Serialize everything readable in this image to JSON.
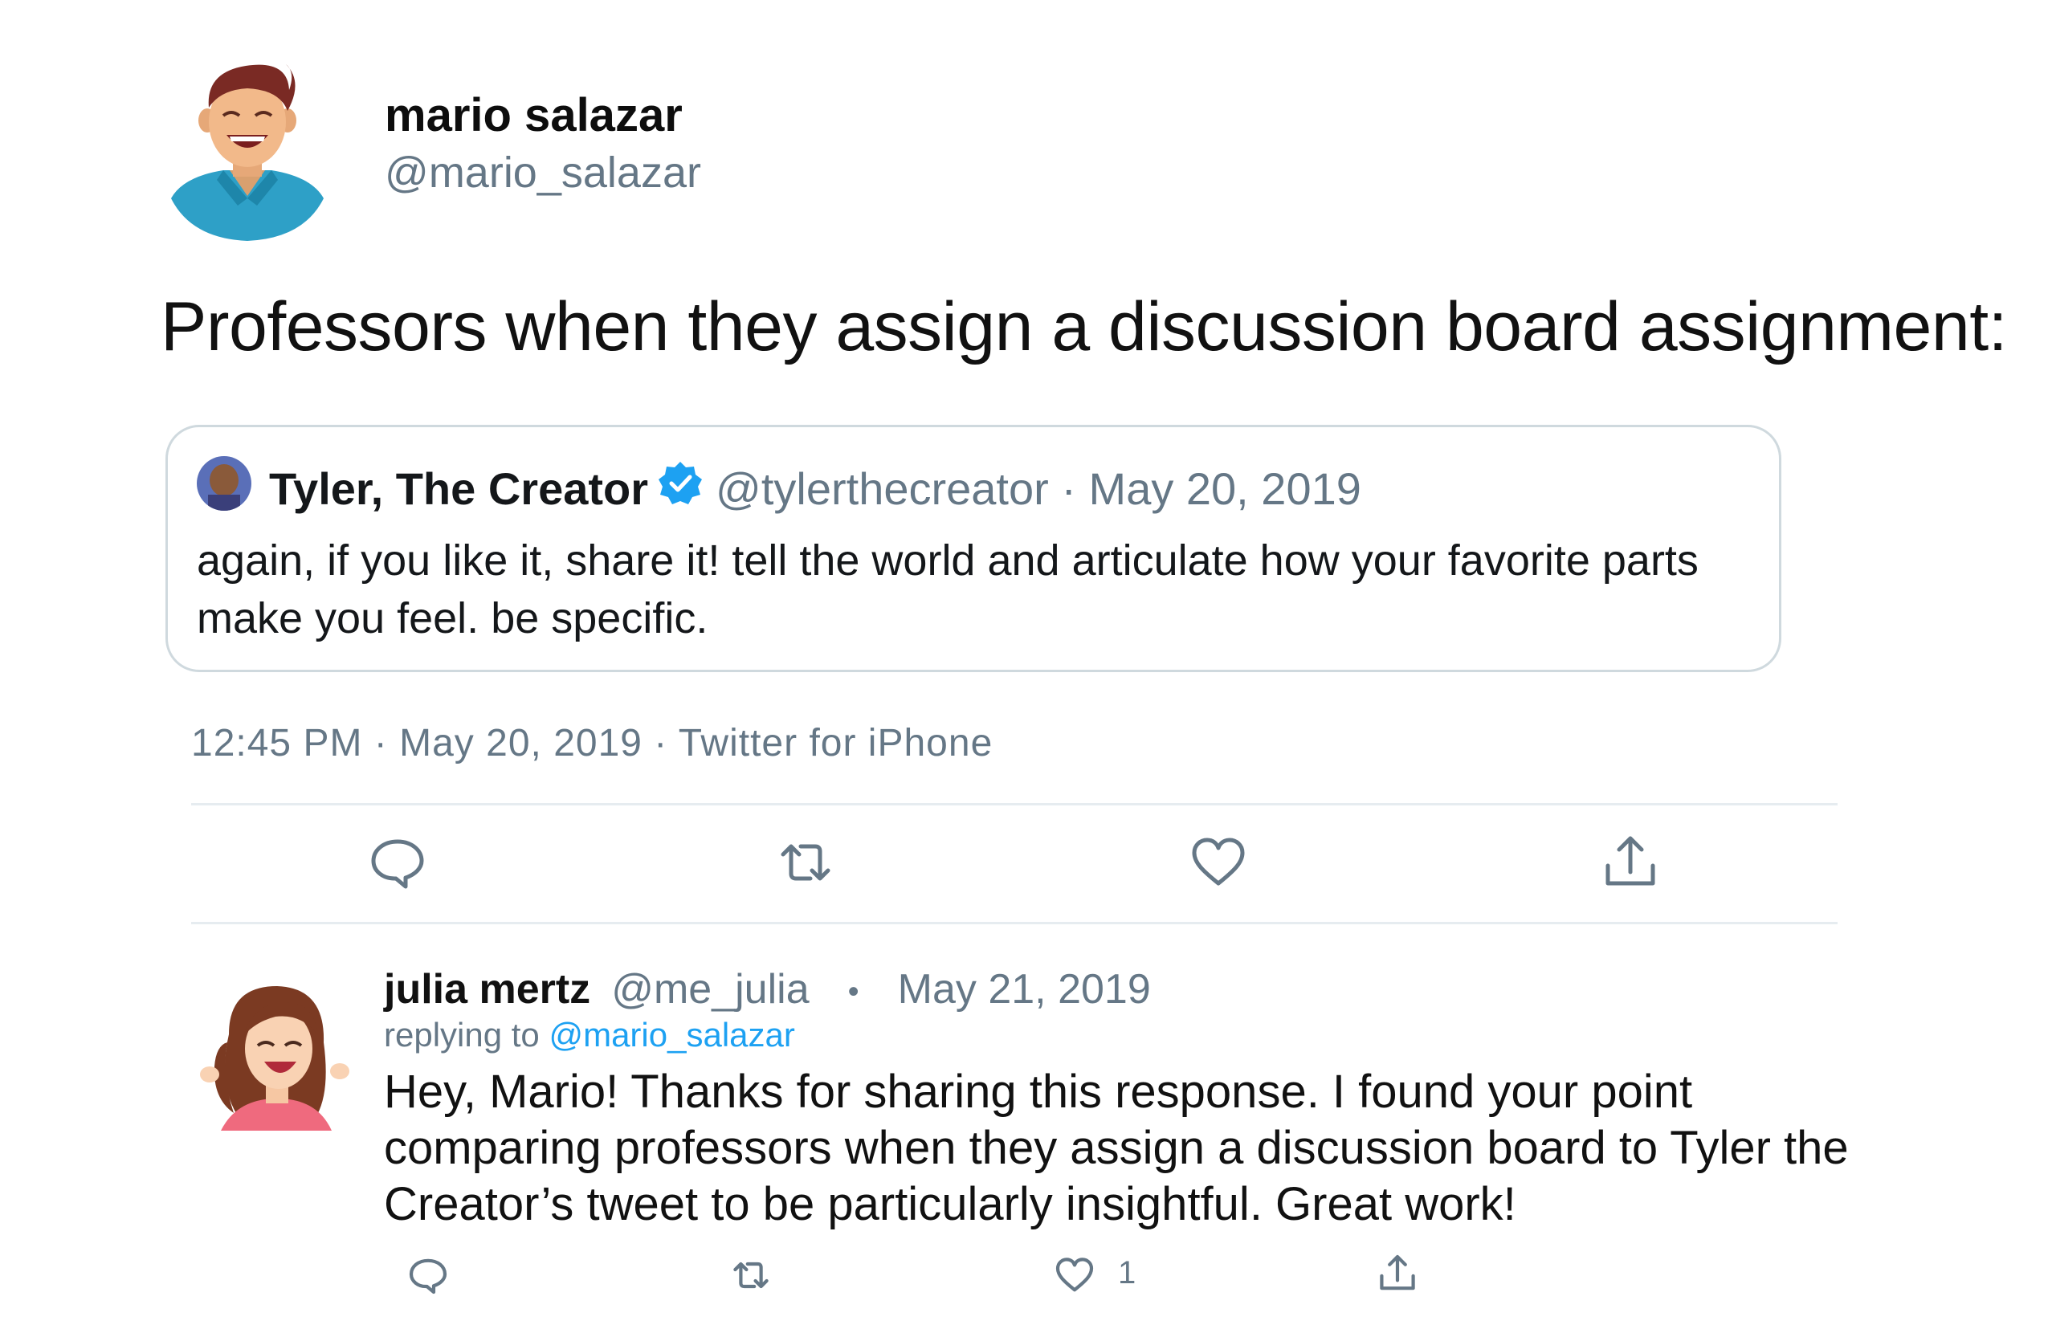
{
  "tweet": {
    "author_name": "mario salazar",
    "author_handle": "@mario_salazar",
    "text": "Professors when they assign a discussion board assignment:",
    "meta": "12:45 PM · May 20, 2019 · Twitter for iPhone"
  },
  "quoted": {
    "name": "Tyler, The Creator",
    "meta": "@tylerthecreator · May 20, 2019",
    "text": "again, if you like it, share it! tell the world and articulate how your favorite parts make you feel. be specific."
  },
  "actions": {
    "icons": [
      "reply-icon",
      "retweet-icon",
      "like-icon",
      "share-icon"
    ]
  },
  "reply": {
    "name": "julia mertz",
    "handle": "@me_julia",
    "separator": "•",
    "date": "May 21, 2019",
    "replying_prefix": "replying to",
    "replying_handle": "@mario_salazar",
    "text": "Hey, Mario! Thanks for sharing this response. I found your point comparing professors when they assign a discussion board to Tyler the Creator’s tweet to be particularly insightful.  Great work!",
    "like_count": "1"
  },
  "colors": {
    "accent": "#1da1f2",
    "muted": "#657786",
    "border": "#cfd9de"
  }
}
